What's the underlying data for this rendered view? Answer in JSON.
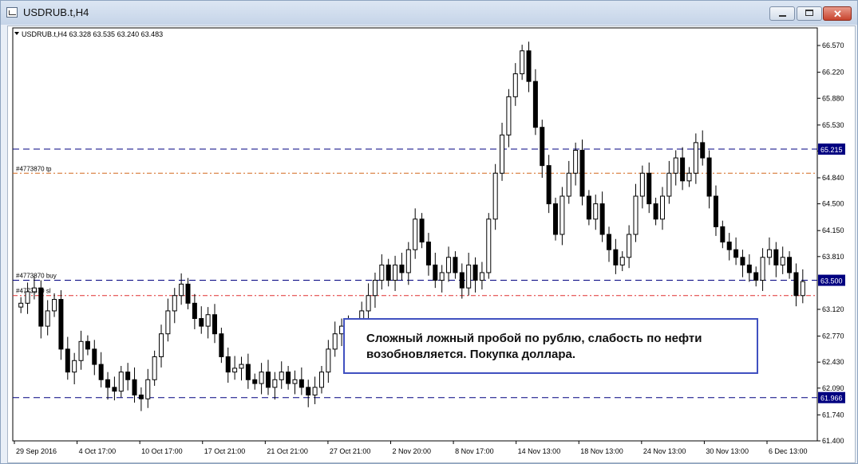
{
  "window": {
    "title": "USDRUB.t,H4"
  },
  "chart_data": {
    "type": "candlestick",
    "symbol_info": "USDRUB.t,H4",
    "ohlc_readout": "63.328 63.535 63.240 63.483",
    "y_ticks": [
      "66.570",
      "66.220",
      "65.880",
      "65.530",
      "65.190",
      "64.840",
      "64.500",
      "64.150",
      "63.810",
      "63.120",
      "62.770",
      "62.430",
      "62.090",
      "61.740",
      "61.400"
    ],
    "ylim": [
      61.4,
      66.8
    ],
    "x_ticks": [
      "29 Sep 2016",
      "4 Oct 17:00",
      "10 Oct 17:00",
      "17 Oct 21:00",
      "21 Oct 21:00",
      "27 Oct 21:00",
      "2 Nov 20:00",
      "8 Nov 17:00",
      "14 Nov 13:00",
      "18 Nov 13:00",
      "24 Nov 13:00",
      "30 Nov 13:00",
      "6 Dec 13:00"
    ],
    "levels": [
      {
        "name": "resistance",
        "price": 65.215,
        "label": "65.215",
        "color": "#000080",
        "style": "dash"
      },
      {
        "name": "tp",
        "price": 64.9,
        "label": "#4773870 tp",
        "color": "#d2691e",
        "style": "dashdot"
      },
      {
        "name": "buy",
        "price": 63.5,
        "label": "#4773870 buy",
        "color": "#000080",
        "style": "dash",
        "price_label": "63.500"
      },
      {
        "name": "sl",
        "price": 63.3,
        "label": "#4773870 sl",
        "color": "#e03030",
        "style": "dashdot"
      },
      {
        "name": "support",
        "price": 61.966,
        "label": "61.966",
        "color": "#000080",
        "style": "dash"
      }
    ],
    "closes": [
      63.2,
      63.35,
      63.4,
      62.9,
      63.1,
      63.25,
      62.6,
      62.3,
      62.45,
      62.7,
      62.6,
      62.4,
      62.2,
      62.1,
      62.05,
      62.3,
      62.2,
      62.0,
      61.95,
      62.2,
      62.5,
      62.8,
      63.1,
      63.3,
      63.45,
      63.2,
      63.0,
      62.9,
      63.05,
      62.8,
      62.5,
      62.3,
      62.35,
      62.4,
      62.2,
      62.15,
      62.3,
      62.1,
      62.2,
      62.3,
      62.15,
      62.2,
      62.1,
      62.0,
      62.1,
      62.3,
      62.6,
      62.8,
      62.9,
      62.7,
      62.9,
      63.1,
      63.3,
      63.5,
      63.7,
      63.5,
      63.7,
      63.6,
      63.9,
      64.3,
      64.0,
      63.7,
      63.5,
      63.6,
      63.8,
      63.6,
      63.4,
      63.7,
      63.5,
      63.6,
      64.3,
      64.9,
      65.4,
      65.9,
      66.2,
      66.5,
      66.1,
      65.5,
      65.0,
      64.5,
      64.1,
      64.6,
      64.9,
      65.2,
      64.6,
      64.3,
      64.5,
      64.1,
      63.9,
      63.7,
      63.8,
      64.1,
      64.6,
      64.9,
      64.5,
      64.3,
      64.6,
      64.9,
      65.1,
      64.8,
      64.9,
      65.3,
      65.1,
      64.6,
      64.2,
      64.0,
      63.9,
      63.8,
      63.7,
      63.6,
      63.5,
      63.8,
      63.9,
      63.7,
      63.8,
      63.6,
      63.3,
      63.483
    ],
    "bar_color": "#000000"
  },
  "annotation": {
    "text": "Сложный ложный пробой по рублю, слабость по нефти возобновляется. Покупка доллара."
  }
}
